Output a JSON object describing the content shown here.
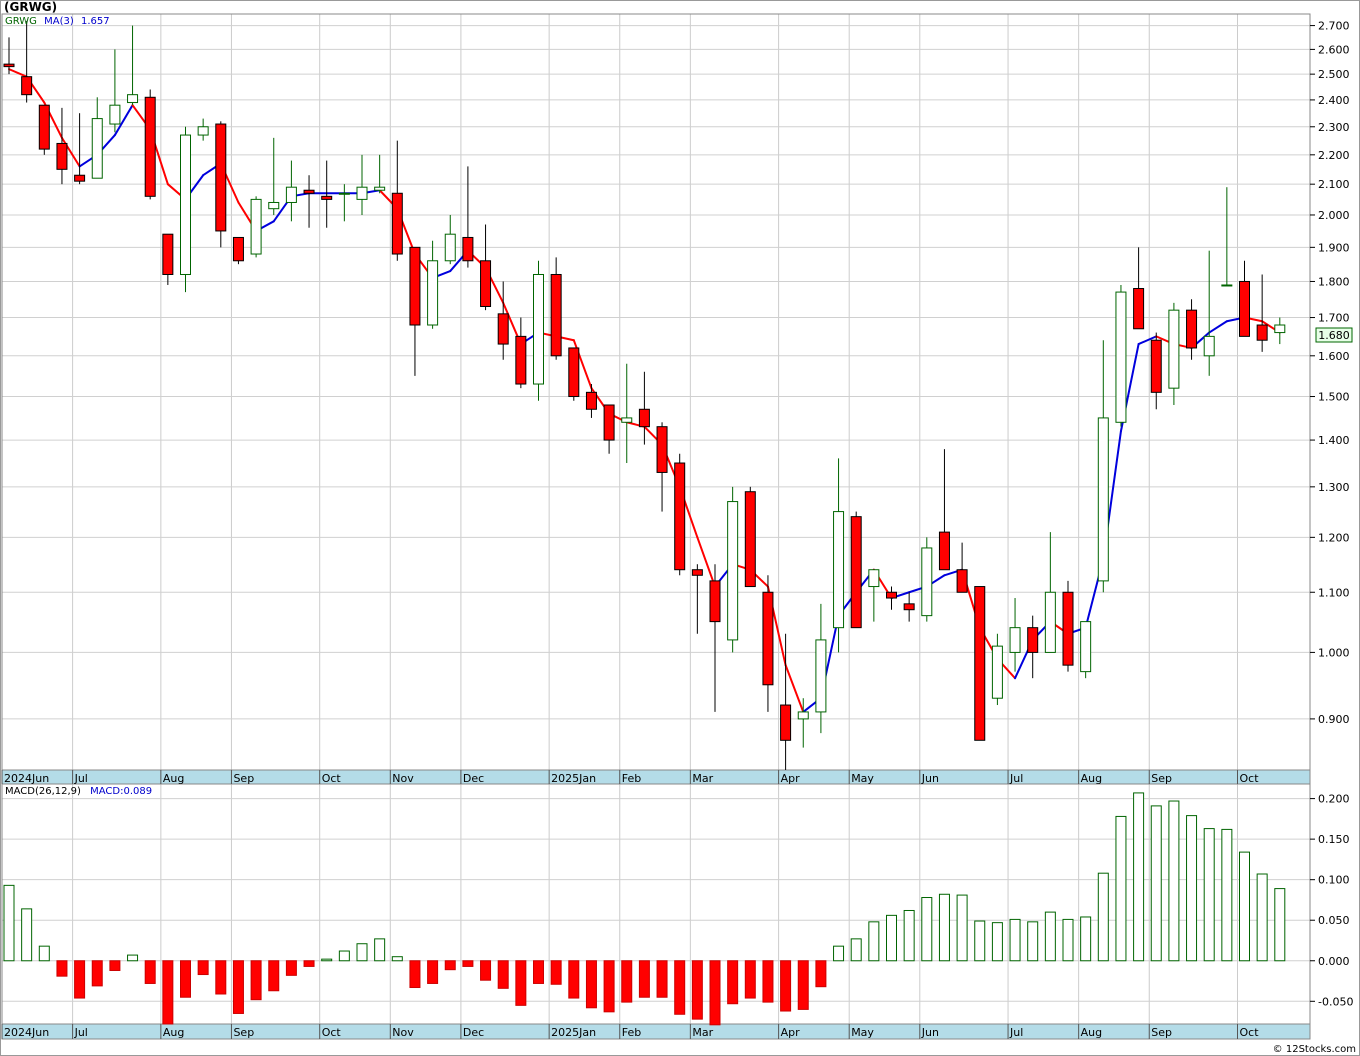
{
  "header": {
    "symbol": "(GRWG)"
  },
  "legend": {
    "ticker": "GRWG",
    "ma_label": "MA(3)",
    "ma_value": "1.657",
    "macd_label": "MACD(26,12,9)",
    "macd_value": "MACD:0.089"
  },
  "last_price_tag": "1.680",
  "copyright": "© 12Stocks.com",
  "colors": {
    "up": "#006400",
    "down": "#ff0000",
    "ma_up": "#0000dd",
    "ma_down": "#ff0000",
    "axis_band": "#b4dce8"
  },
  "chart_data": [
    {
      "type": "candlestick",
      "title": "GRWG",
      "scale": "log",
      "ylim": [
        0.83,
        2.75
      ],
      "yticks": [
        "2.700",
        "2.600",
        "2.500",
        "2.400",
        "2.300",
        "2.200",
        "2.100",
        "2.000",
        "1.900",
        "1.800",
        "1.700",
        "1.600",
        "1.500",
        "1.400",
        "1.300",
        "1.200",
        "1.100",
        "1.000",
        "0.900"
      ],
      "x_labels": [
        "2024Jun",
        "Jul",
        "Aug",
        "Sep",
        "Oct",
        "Nov",
        "Dec",
        "2025Jan",
        "Feb",
        "Mar",
        "Apr",
        "May",
        "Jun",
        "Jul",
        "Aug",
        "Sep",
        "Oct"
      ],
      "x_label_week": [
        0,
        4,
        9,
        13,
        18,
        22,
        26,
        31,
        35,
        39,
        44,
        48,
        52,
        57,
        61,
        65,
        70
      ],
      "candles": [
        [
          2.54,
          2.65,
          2.5,
          2.53
        ],
        [
          2.49,
          2.72,
          2.39,
          2.42
        ],
        [
          2.38,
          2.38,
          2.2,
          2.22
        ],
        [
          2.24,
          2.37,
          2.1,
          2.15
        ],
        [
          2.13,
          2.35,
          2.1,
          2.11
        ],
        [
          2.12,
          2.41,
          2.12,
          2.33
        ],
        [
          2.31,
          2.6,
          2.28,
          2.38
        ],
        [
          2.39,
          2.7,
          2.38,
          2.42
        ],
        [
          2.41,
          2.44,
          2.05,
          2.06
        ],
        [
          1.94,
          1.94,
          1.79,
          1.82
        ],
        [
          1.82,
          2.3,
          1.77,
          2.27
        ],
        [
          2.27,
          2.33,
          2.25,
          2.3
        ],
        [
          2.31,
          2.32,
          1.9,
          1.95
        ],
        [
          1.93,
          1.93,
          1.85,
          1.86
        ],
        [
          1.88,
          2.06,
          1.87,
          2.05
        ],
        [
          2.02,
          2.26,
          2.0,
          2.04
        ],
        [
          2.04,
          2.18,
          1.98,
          2.09
        ],
        [
          2.08,
          2.13,
          1.96,
          2.07
        ],
        [
          2.06,
          2.18,
          1.96,
          2.05
        ],
        [
          2.07,
          2.1,
          1.98,
          2.07
        ],
        [
          2.05,
          2.2,
          2.0,
          2.09
        ],
        [
          2.08,
          2.2,
          2.07,
          2.09
        ],
        [
          2.07,
          2.25,
          1.86,
          1.88
        ],
        [
          1.9,
          1.9,
          1.55,
          1.68
        ],
        [
          1.68,
          1.92,
          1.67,
          1.86
        ],
        [
          1.86,
          2.0,
          1.85,
          1.94
        ],
        [
          1.93,
          2.16,
          1.84,
          1.86
        ],
        [
          1.86,
          1.97,
          1.72,
          1.73
        ],
        [
          1.71,
          1.8,
          1.59,
          1.63
        ],
        [
          1.65,
          1.7,
          1.52,
          1.53
        ],
        [
          1.53,
          1.86,
          1.49,
          1.82
        ],
        [
          1.82,
          1.87,
          1.59,
          1.6
        ],
        [
          1.62,
          1.62,
          1.49,
          1.5
        ],
        [
          1.51,
          1.53,
          1.45,
          1.47
        ],
        [
          1.48,
          1.48,
          1.37,
          1.4
        ],
        [
          1.44,
          1.58,
          1.35,
          1.45
        ],
        [
          1.47,
          1.56,
          1.39,
          1.43
        ],
        [
          1.43,
          1.44,
          1.25,
          1.33
        ],
        [
          1.35,
          1.37,
          1.13,
          1.14
        ],
        [
          1.14,
          1.15,
          1.03,
          1.13
        ],
        [
          1.12,
          1.15,
          0.91,
          1.05
        ],
        [
          1.02,
          1.3,
          1.0,
          1.27
        ],
        [
          1.29,
          1.3,
          1.11,
          1.11
        ],
        [
          1.1,
          1.13,
          0.91,
          0.95
        ],
        [
          0.92,
          1.03,
          0.83,
          0.87
        ],
        [
          0.9,
          0.93,
          0.86,
          0.91
        ],
        [
          0.91,
          1.08,
          0.88,
          1.02
        ],
        [
          1.04,
          1.36,
          1.0,
          1.25
        ],
        [
          1.24,
          1.25,
          1.04,
          1.04
        ],
        [
          1.11,
          1.14,
          1.05,
          1.14
        ],
        [
          1.1,
          1.11,
          1.07,
          1.09
        ],
        [
          1.08,
          1.1,
          1.05,
          1.07
        ],
        [
          1.06,
          1.2,
          1.05,
          1.18
        ],
        [
          1.21,
          1.38,
          1.14,
          1.14
        ],
        [
          1.14,
          1.19,
          1.1,
          1.1
        ],
        [
          1.11,
          1.11,
          0.87,
          0.87
        ],
        [
          0.93,
          1.03,
          0.92,
          1.01
        ],
        [
          1.0,
          1.09,
          0.97,
          1.04
        ],
        [
          1.04,
          1.06,
          0.96,
          1.0
        ],
        [
          1.0,
          1.21,
          1.0,
          1.1
        ],
        [
          1.1,
          1.12,
          0.97,
          0.98
        ],
        [
          0.97,
          1.05,
          0.96,
          1.05
        ],
        [
          1.12,
          1.64,
          1.1,
          1.45
        ],
        [
          1.44,
          1.79,
          1.43,
          1.77
        ],
        [
          1.78,
          1.9,
          1.68,
          1.67
        ],
        [
          1.64,
          1.66,
          1.47,
          1.51
        ],
        [
          1.52,
          1.74,
          1.48,
          1.72
        ],
        [
          1.72,
          1.75,
          1.59,
          1.62
        ],
        [
          1.6,
          1.89,
          1.55,
          1.65
        ],
        [
          1.79,
          2.09,
          1.79,
          1.79
        ],
        [
          1.8,
          1.86,
          1.65,
          1.65
        ],
        [
          1.68,
          1.82,
          1.61,
          1.64
        ],
        [
          1.66,
          1.7,
          1.63,
          1.68
        ]
      ],
      "ma3": [
        2.52,
        2.49,
        2.39,
        2.26,
        2.16,
        2.2,
        2.27,
        2.38,
        2.29,
        2.1,
        2.05,
        2.13,
        2.17,
        2.04,
        1.95,
        1.98,
        2.06,
        2.07,
        2.07,
        2.07,
        2.07,
        2.08,
        2.02,
        1.88,
        1.81,
        1.83,
        1.89,
        1.84,
        1.74,
        1.63,
        1.66,
        1.65,
        1.64,
        1.52,
        1.46,
        1.44,
        1.43,
        1.39,
        1.3,
        1.2,
        1.11,
        1.15,
        1.14,
        1.11,
        0.98,
        0.91,
        0.93,
        1.06,
        1.1,
        1.14,
        1.09,
        1.1,
        1.11,
        1.13,
        1.14,
        1.04,
        0.99,
        0.96,
        1.02,
        1.05,
        1.03,
        1.04,
        1.16,
        1.42,
        1.63,
        1.65,
        1.63,
        1.62,
        1.66,
        1.69,
        1.7,
        1.69,
        1.66
      ]
    },
    {
      "type": "bar",
      "title": "MACD(26,12,9)",
      "ylim": [
        -0.078,
        0.218
      ],
      "yticks": [
        "0.200",
        "0.150",
        "0.100",
        "0.050",
        "0.000",
        "-0.050"
      ],
      "values": [
        0.093,
        0.064,
        0.018,
        -0.019,
        -0.046,
        -0.031,
        -0.012,
        0.007,
        -0.028,
        -0.078,
        -0.045,
        -0.017,
        -0.041,
        -0.065,
        -0.048,
        -0.037,
        -0.018,
        -0.007,
        0.002,
        0.012,
        0.021,
        0.027,
        0.005,
        -0.033,
        -0.028,
        -0.011,
        -0.007,
        -0.024,
        -0.034,
        -0.055,
        -0.028,
        -0.029,
        -0.046,
        -0.058,
        -0.063,
        -0.051,
        -0.045,
        -0.045,
        -0.066,
        -0.072,
        -0.079,
        -0.053,
        -0.046,
        -0.051,
        -0.062,
        -0.06,
        -0.032,
        0.018,
        0.027,
        0.048,
        0.056,
        0.062,
        0.078,
        0.082,
        0.081,
        0.049,
        0.047,
        0.051,
        0.048,
        0.06,
        0.051,
        0.054,
        0.108,
        0.178,
        0.207,
        0.191,
        0.197,
        0.179,
        0.163,
        0.162,
        0.134,
        0.107,
        0.089
      ]
    }
  ]
}
